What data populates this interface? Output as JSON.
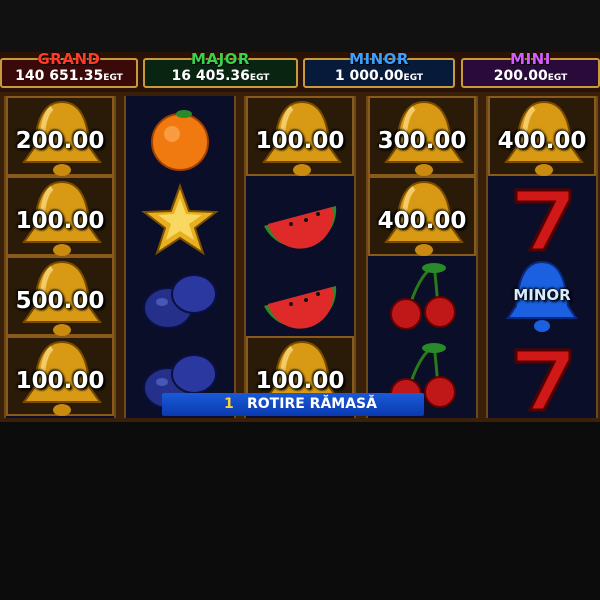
{
  "jackpots": {
    "grand": {
      "label": "GRAND",
      "amount": "140 651.35",
      "suffix": "EGT"
    },
    "major": {
      "label": "MAJOR",
      "amount": "16 405.36",
      "suffix": "EGT"
    },
    "minor": {
      "label": "MINOR",
      "amount": "1 000.00",
      "suffix": "EGT"
    },
    "mini": {
      "label": "MINI",
      "amount": "200.00",
      "suffix": "EGT"
    }
  },
  "reels": {
    "r1": [
      "200.00",
      "100.00",
      "500.00",
      "100.00"
    ],
    "r2": [
      "orange-icon",
      "star-icon",
      "plum-icon",
      "plum-icon"
    ],
    "r3": [
      "100.00",
      "watermelon-icon",
      "watermelon-icon",
      "100.00"
    ],
    "r4": [
      "300.00",
      "400.00",
      "cherry-icon",
      "cherry-icon"
    ],
    "r5": [
      "400.00",
      "seven-icon",
      "MINOR",
      "seven-icon"
    ]
  },
  "banner": {
    "count": "1",
    "text": "ROTIRE RĂMASĂ"
  },
  "colors": {
    "gold": "#e8a81a",
    "grand": "#ff3a2a",
    "major": "#39d24b",
    "minor": "#3aa0ff",
    "mini": "#d45cff"
  }
}
